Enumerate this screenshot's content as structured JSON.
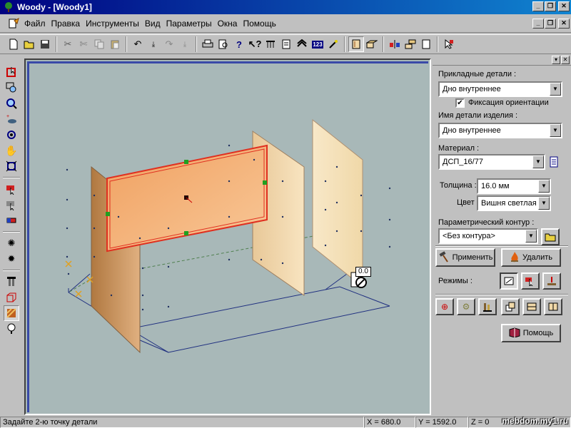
{
  "window": {
    "title": "Woody - [Woody1]"
  },
  "menu": {
    "items": [
      "Файл",
      "Правка",
      "Инструменты",
      "Вид",
      "Параметры",
      "Окна",
      "Помощь"
    ]
  },
  "toolbar": {
    "icons": [
      "new-icon",
      "open-icon",
      "save-icon",
      "cut-icon",
      "scissors-icon",
      "copy-icon",
      "paste-icon",
      "undo-icon",
      "undo-step-icon",
      "redo-icon",
      "redo-step-icon",
      "print-icon",
      "preview-icon",
      "help-icon",
      "context-help-icon",
      "columns-icon",
      "document-icon",
      "layers-icon",
      "numbers-icon",
      "wand-icon",
      "panel-icon",
      "box-icon",
      "split-icon",
      "arrange-icon",
      "page-icon",
      "pointer-icon"
    ],
    "numbers_label": "123"
  },
  "viewport": {
    "snap_value": "0.0"
  },
  "panel": {
    "applied_parts_label": "Прикладные детали :",
    "applied_parts_value": "Дно внутреннее",
    "fix_orientation_label": "Фиксация ориентации",
    "fix_orientation_checked": true,
    "part_name_label": "Имя детали изделия :",
    "part_name_value": "Дно внутреннее",
    "material_label": "Материал :",
    "material_value": "ДСП_16/77",
    "thickness_label": "Толщина :",
    "thickness_value": "16.0 мм",
    "color_label": "Цвет :",
    "color_value": "Вишня светлая",
    "contour_label": "Параметрический контур :",
    "contour_value": "<Без контура>",
    "apply_button": "Применить",
    "delete_button": "Удалить",
    "modes_label": "Режимы :",
    "help_button": "Помощь"
  },
  "status": {
    "message": "Задайте 2-ю точку детали",
    "x": "X = 680.0",
    "y": "Y = 1592.0",
    "z": "Z = 0"
  },
  "watermark": "mebdom.my1.ru",
  "colors": {
    "titlebar": "#000080",
    "viewport_bg": "#a8b8b8",
    "panel_wood": "#f0d8a8",
    "selected_panel": "#f0a060",
    "selection_outline": "#e03020"
  }
}
